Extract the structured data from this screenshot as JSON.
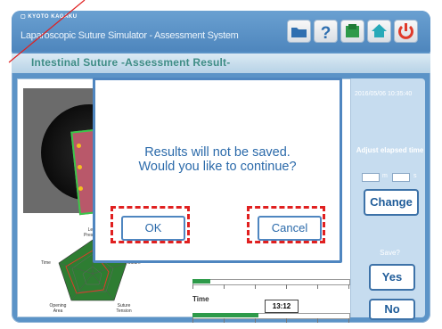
{
  "header": {
    "brand": "KYOTO KAGAKU",
    "title": "Laparoscopic Suture Simulator - Assessment System",
    "icons": [
      "folder-icon",
      "help-icon",
      "download-icon",
      "home-icon",
      "power-icon"
    ]
  },
  "subheader": {
    "title": "Intestinal Suture -Assessment Result-"
  },
  "right_panel": {
    "datetime": "2016/05/06 10:35:40",
    "adjust_label": "Adjust elapsed time",
    "minute_unit": "m",
    "second_unit": "s",
    "change_button": "Change",
    "save_label": "Save?",
    "yes_button": "Yes",
    "no_button": "No"
  },
  "radar": {
    "axes": [
      "Leak Pressure",
      "Suture",
      "Suture Tension",
      "Opening Area",
      "Time"
    ]
  },
  "timeline": {
    "label": "Time",
    "value": "13:12",
    "progress": 0.42
  },
  "dialog": {
    "message_line1": "Results will not be saved.",
    "message_line2": "Would you like to continue?",
    "ok_button": "OK",
    "cancel_button": "Cancel"
  },
  "colors": {
    "accent": "#4f86c0",
    "highlight": "#e02020",
    "header_bg": "#5b93c7",
    "subtitle": "#3f8d86"
  }
}
